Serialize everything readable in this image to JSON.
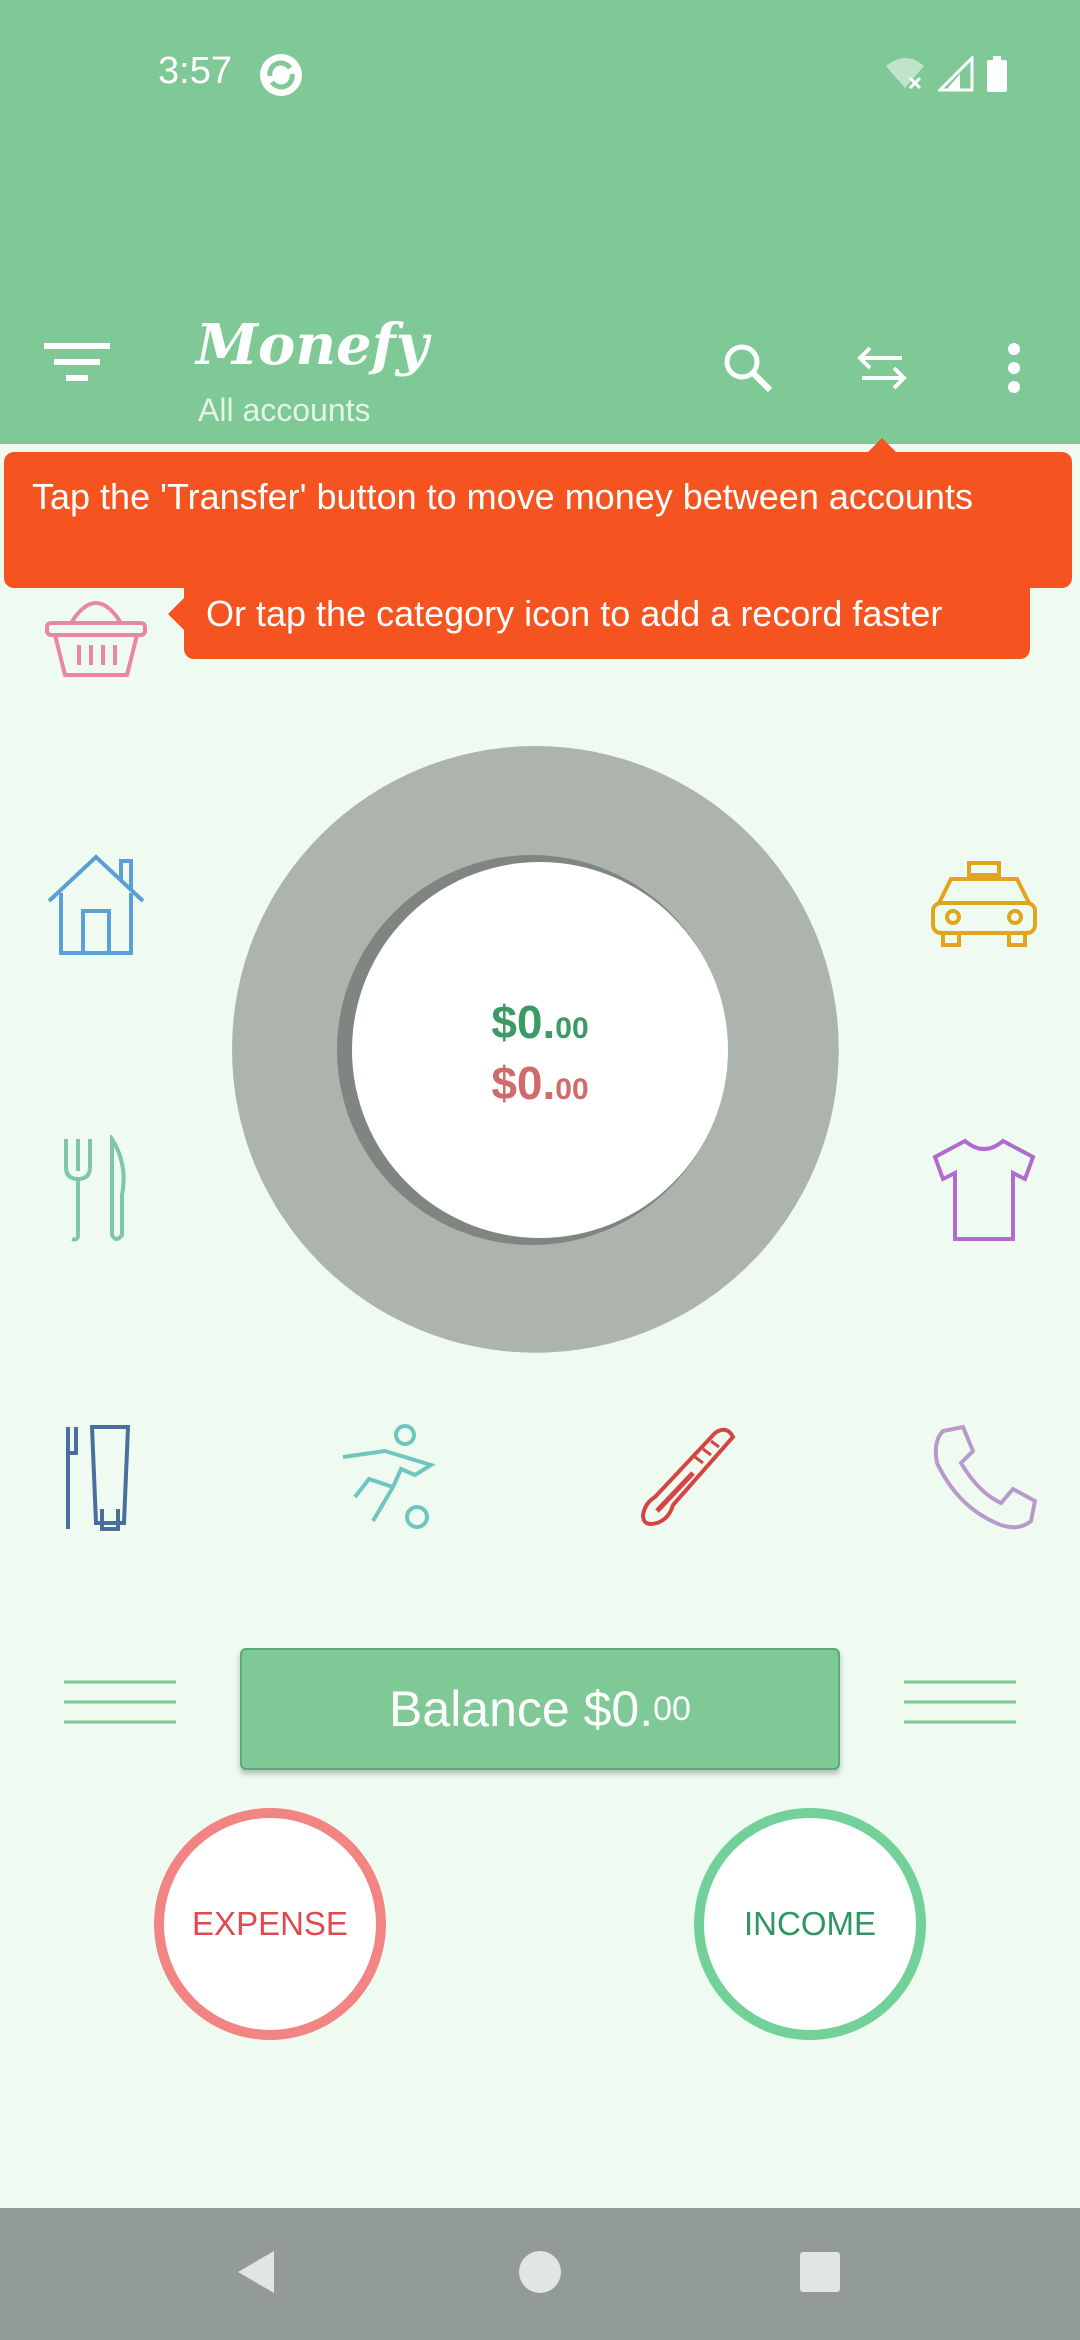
{
  "status_bar": {
    "time": "3:57",
    "icons": [
      "sync-app-icon",
      "wifi-off-icon",
      "signal-icon",
      "battery-icon"
    ]
  },
  "app_bar": {
    "title": "Monefy",
    "subtitle": "All accounts",
    "icons": [
      "filter-menu-icon",
      "search-icon",
      "transfer-icon",
      "more-vert-icon"
    ]
  },
  "tooltips": {
    "transfer_hint": "Tap the 'Transfer' button to move money between accounts",
    "category_hint": "Or tap the category icon to add a record faster"
  },
  "categories": [
    {
      "name": "groceries",
      "icon": "basket-icon",
      "color": "#e986a8"
    },
    {
      "name": "house",
      "icon": "house-icon",
      "color": "#5b9fd6"
    },
    {
      "name": "taxi",
      "icon": "taxi-icon",
      "color": "#e0a51a"
    },
    {
      "name": "eating-out",
      "icon": "fork-knife-icon",
      "color": "#7fc7a6"
    },
    {
      "name": "clothes",
      "icon": "tshirt-icon",
      "color": "#b06bd0"
    },
    {
      "name": "toiletry",
      "icon": "toothbrush-icon",
      "color": "#4a6f9c"
    },
    {
      "name": "sports",
      "icon": "soccer-player-icon",
      "color": "#6fc6bf"
    },
    {
      "name": "health",
      "icon": "thermometer-icon",
      "color": "#d64545"
    },
    {
      "name": "communications",
      "icon": "phone-icon",
      "color": "#b79ac9"
    }
  ],
  "chart_data": {
    "type": "pie",
    "values": [],
    "income_total": "$0.00",
    "expense_total": "$0.00",
    "empty_ring_color": "#adb4ae"
  },
  "totals": {
    "income_main": "$0.",
    "income_cents": "00",
    "expense_main": "$0.",
    "expense_cents": "00"
  },
  "balance": {
    "label_main": "Balance $0.",
    "label_cents": "00"
  },
  "actions": {
    "expense": "EXPENSE",
    "income": "INCOME"
  },
  "colors": {
    "primary": "#7ec995",
    "background": "#effbf1",
    "tooltip": "#f5531f",
    "expense": "#f38484",
    "income": "#72d198"
  },
  "nav": {
    "icons": [
      "back-icon",
      "home-icon",
      "recents-icon"
    ]
  }
}
